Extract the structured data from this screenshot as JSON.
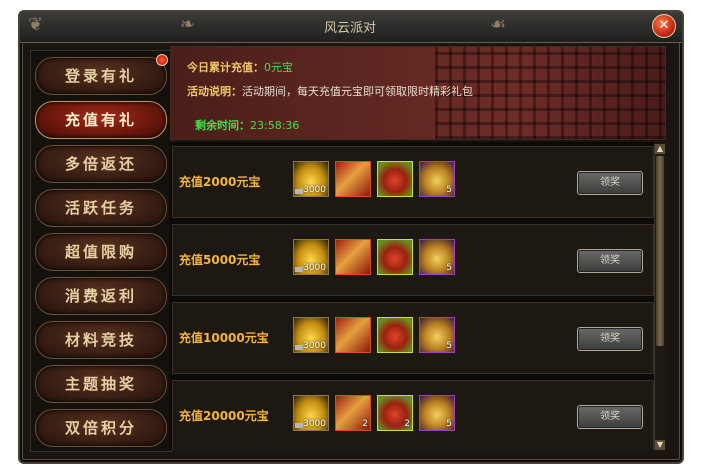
{
  "window": {
    "title": "风云派对",
    "close_label": "✕"
  },
  "sidebar": {
    "items": [
      {
        "label": "登录有礼",
        "active": false,
        "badge": true
      },
      {
        "label": "充值有礼",
        "active": true,
        "badge": false
      },
      {
        "label": "多倍返还",
        "active": false,
        "badge": false
      },
      {
        "label": "活跃任务",
        "active": false,
        "badge": false
      },
      {
        "label": "超值限购",
        "active": false,
        "badge": false
      },
      {
        "label": "消费返利",
        "active": false,
        "badge": false
      },
      {
        "label": "材料竞技",
        "active": false,
        "badge": false
      },
      {
        "label": "主题抽奖",
        "active": false,
        "badge": false
      },
      {
        "label": "双倍积分",
        "active": false,
        "badge": false
      }
    ]
  },
  "banner": {
    "today_label": "今日累计充值：",
    "today_value": "0元宝",
    "desc_label": "活动说明：",
    "desc_value": "活动期间，每天充值元宝即可领取限时精彩礼包",
    "remain_label": "剩余时间：",
    "remain_value": "23:58:36"
  },
  "rewards": [
    {
      "label": "充值2000元宝",
      "items": [
        {
          "icon": "gold-ingot",
          "qty": "3000"
        },
        {
          "icon": "red-book",
          "qty": ""
        },
        {
          "icon": "red-bag",
          "qty": ""
        },
        {
          "icon": "gold-pouch",
          "qty": "5"
        }
      ],
      "button": "领奖"
    },
    {
      "label": "充值5000元宝",
      "items": [
        {
          "icon": "gold-ingot",
          "qty": "3000"
        },
        {
          "icon": "red-book",
          "qty": ""
        },
        {
          "icon": "red-bag",
          "qty": ""
        },
        {
          "icon": "gold-pouch",
          "qty": "5"
        }
      ],
      "button": "领奖"
    },
    {
      "label": "充值10000元宝",
      "items": [
        {
          "icon": "gold-ingot",
          "qty": "3000"
        },
        {
          "icon": "red-book",
          "qty": ""
        },
        {
          "icon": "red-bag",
          "qty": ""
        },
        {
          "icon": "gold-pouch",
          "qty": "5"
        }
      ],
      "button": "领奖"
    },
    {
      "label": "充值20000元宝",
      "items": [
        {
          "icon": "gold-ingot",
          "qty": "3000"
        },
        {
          "icon": "red-book",
          "qty": "2"
        },
        {
          "icon": "red-bag",
          "qty": "2"
        },
        {
          "icon": "gold-pouch",
          "qty": "5"
        }
      ],
      "button": "领奖"
    }
  ]
}
